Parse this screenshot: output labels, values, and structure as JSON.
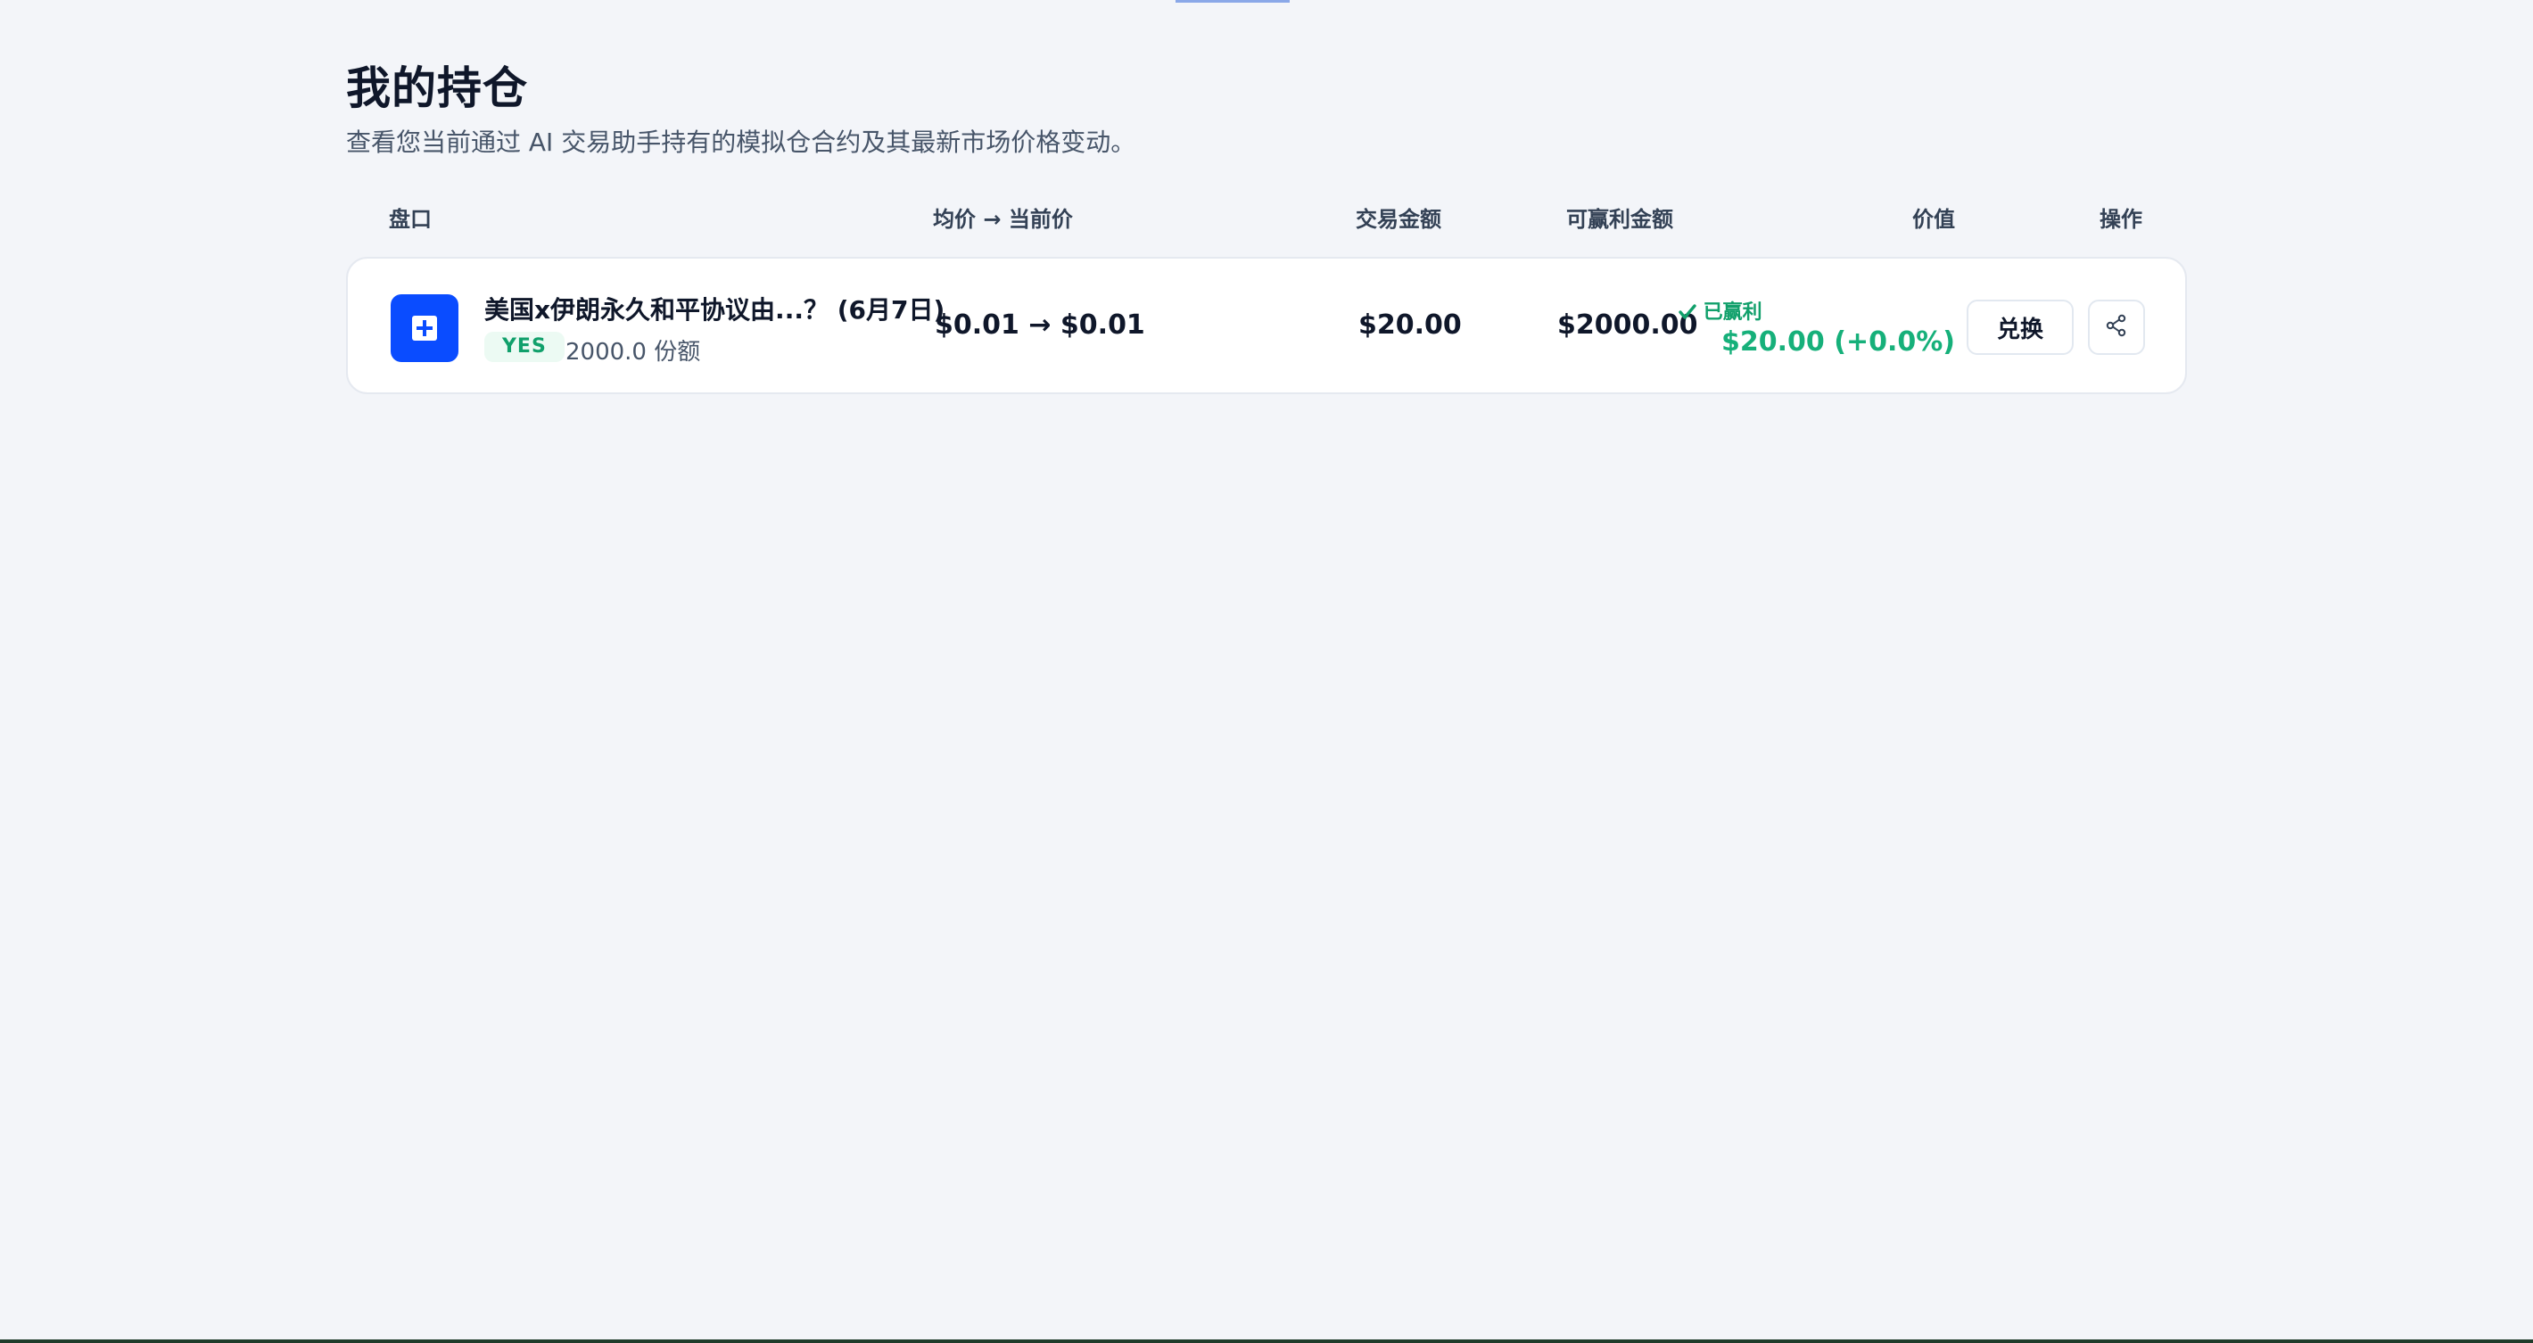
{
  "header": {
    "title": "我的持仓",
    "subtitle": "查看您当前通过 AI 交易助手持有的模拟仓合约及其最新市场价格变动。"
  },
  "table": {
    "columns": {
      "market": "盘口",
      "price": "均价 → 当前价",
      "amount": "交易金额",
      "payout": "可赢利金额",
      "value": "价值",
      "actions": "操作"
    },
    "rows": [
      {
        "title": "美国x伊朗永久和平协议由...？ (6月7日)",
        "outcome": "YES",
        "shares": "2000.0 份额",
        "price": "$0.01 → $0.01",
        "amount": "$20.00",
        "payout": "$2000.00",
        "status": "已赢利",
        "value": "$20.00 (+0.0%)",
        "redeem_label": "兑换"
      }
    ]
  },
  "icons": {
    "market": "plus-square-icon",
    "status": "check-icon",
    "share": "share-icon"
  },
  "colors": {
    "accent": "#0a4cff",
    "positive": "#16b07a",
    "background": "#f3f5f9"
  }
}
